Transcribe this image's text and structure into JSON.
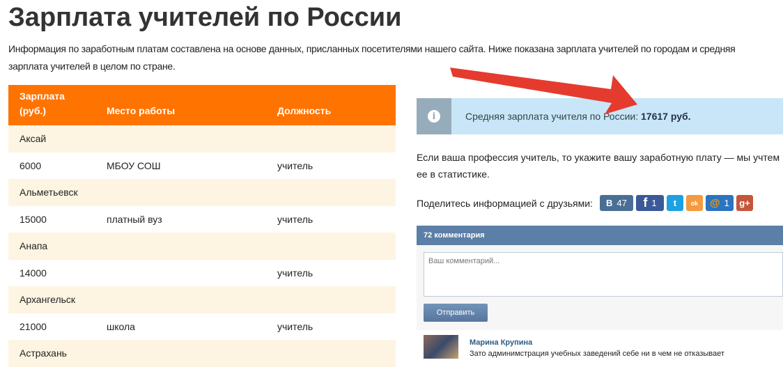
{
  "title": "Зарплата учителей по России",
  "intro": "Информация по заработным платам составлена на основе данных, присланных посетителями нашего сайта. Ниже показана зарплата учителей по городам и средняя зарплата учителей в целом по стране.",
  "table": {
    "headers": [
      "Зарплата (руб.)",
      "Место работы",
      "Должность"
    ],
    "rows": [
      {
        "city": "Аксай"
      },
      {
        "salary": "6000",
        "place": "МБОУ СОШ",
        "position": "учитель"
      },
      {
        "city": "Альметьевск"
      },
      {
        "salary": "15000",
        "place": "платный вуз",
        "position": "учитель"
      },
      {
        "city": "Анапа"
      },
      {
        "salary": "14000",
        "place": "",
        "position": "учитель"
      },
      {
        "city": "Архангельск"
      },
      {
        "salary": "21000",
        "place": "школа",
        "position": "учитель"
      },
      {
        "city": "Астрахань"
      }
    ]
  },
  "info": {
    "text": "Средняя зарплата учителя по России: ",
    "value": "17617 руб."
  },
  "prompt": "Если ваша профессия учитель, то укажите вашу заработную плату — мы учтем ее в статистике.",
  "share": {
    "label": "Поделитесь информацией с друзьями:",
    "vk": "В",
    "vk_count": "47",
    "fb": "f",
    "fb_count": "1",
    "tw": "t",
    "ok": "ok",
    "mail": "@",
    "mail_count": "1",
    "gp": "g+"
  },
  "comments": {
    "count_label": "72 комментария",
    "placeholder": "Ваш комментарий...",
    "send": "Отправить",
    "items": [
      {
        "author": "Марина Крупина",
        "text": "Зато админимстрация учебных заведений себе ни в чем не отказывает"
      }
    ]
  },
  "colors": {
    "orange": "#ff7300",
    "info_bg": "#c8e6f8",
    "arrow": "#e53b2f"
  }
}
